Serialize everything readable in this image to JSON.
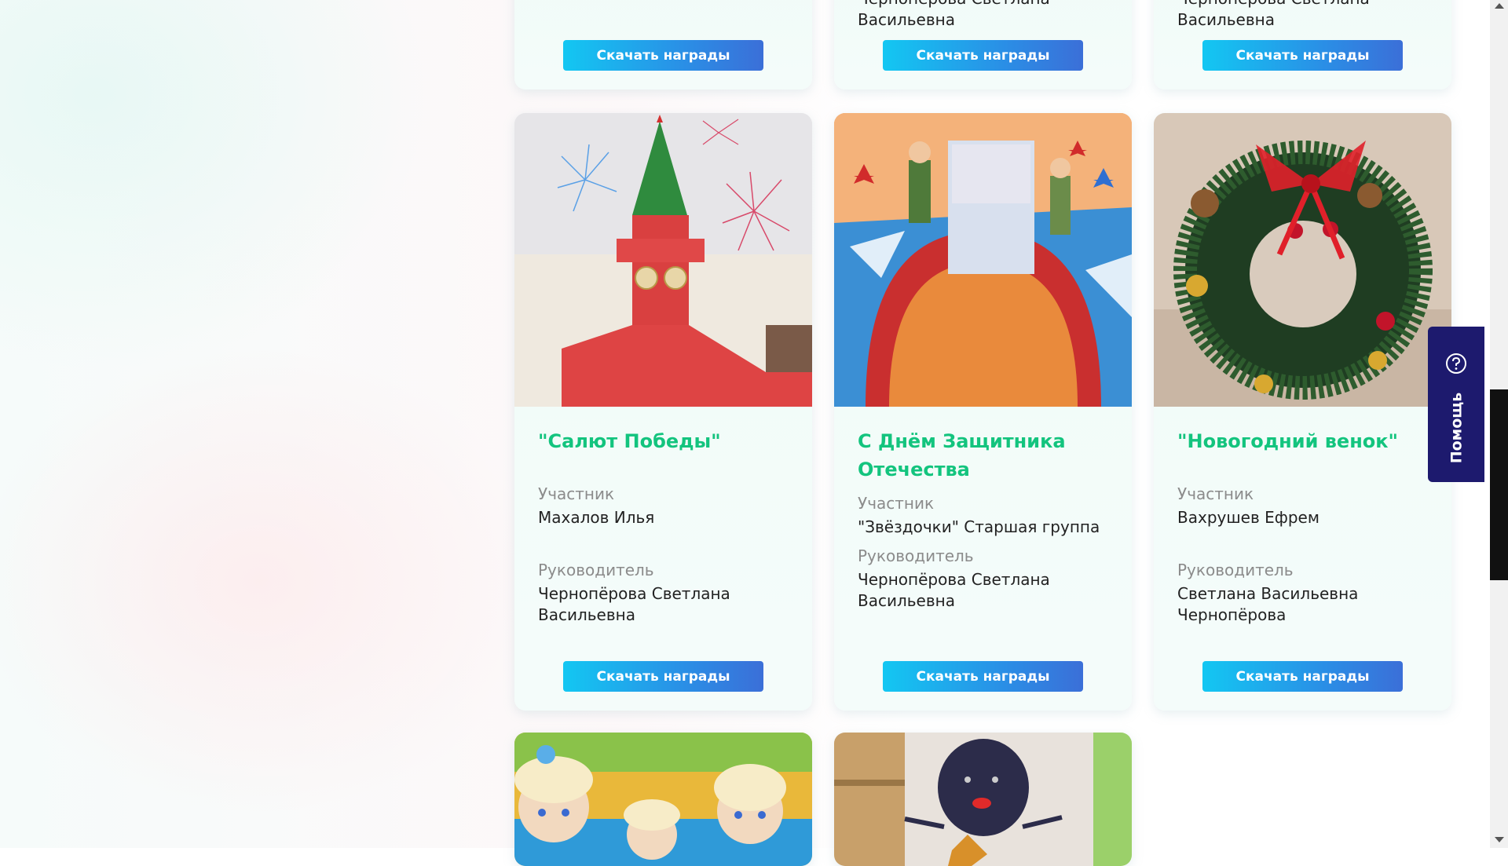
{
  "cards_top": [
    {
      "leader_name": "",
      "download_label": "Скачать награды"
    },
    {
      "leader_name": "Чернопёрова Светлана Васильевна",
      "download_label": "Скачать награды"
    },
    {
      "leader_name": "Чернопёрова Светлана Васильевна",
      "download_label": "Скачать награды"
    }
  ],
  "cards": [
    {
      "title": "\"Салют Победы\"",
      "participant_label": "Участник",
      "participant": "Махалов Илья",
      "leader_label": "Руководитель",
      "leader": "Чернопёрова Светлана Васильевна",
      "download_label": "Скачать награды",
      "image_subject": "drawing of Kremlin tower with fireworks"
    },
    {
      "title": "С Днём Защитника Отечества",
      "participant_label": "Участник",
      "participant": "\"Звёздочки\" Старшая группа",
      "leader_label": "Руководитель",
      "leader": "Чернопёрова Светлана Васильевна",
      "download_label": "Скачать награды",
      "image_subject": "23 February craft with soldiers and airplanes"
    },
    {
      "title": "\"Новогодний венок\"",
      "participant_label": "Участник",
      "participant": "Вахрушев Ефрем",
      "leader_label": "Руководитель",
      "leader": "Светлана Васильевна Чернопёрова",
      "download_label": "Скачать награды",
      "image_subject": "christmas wreath with red bow"
    }
  ],
  "cards_bottom": [
    {
      "image_subject": "dolls in blue knitted clothes"
    },
    {
      "image_subject": "craft figure on shelf"
    }
  ],
  "help": {
    "label": "Помощь",
    "icon": "help-bubble-icon"
  },
  "colors": {
    "title_green": "#13c47e",
    "button_start": "#13c7f2",
    "button_end": "#3b6fd8",
    "help_bg": "#1d1a6e"
  }
}
